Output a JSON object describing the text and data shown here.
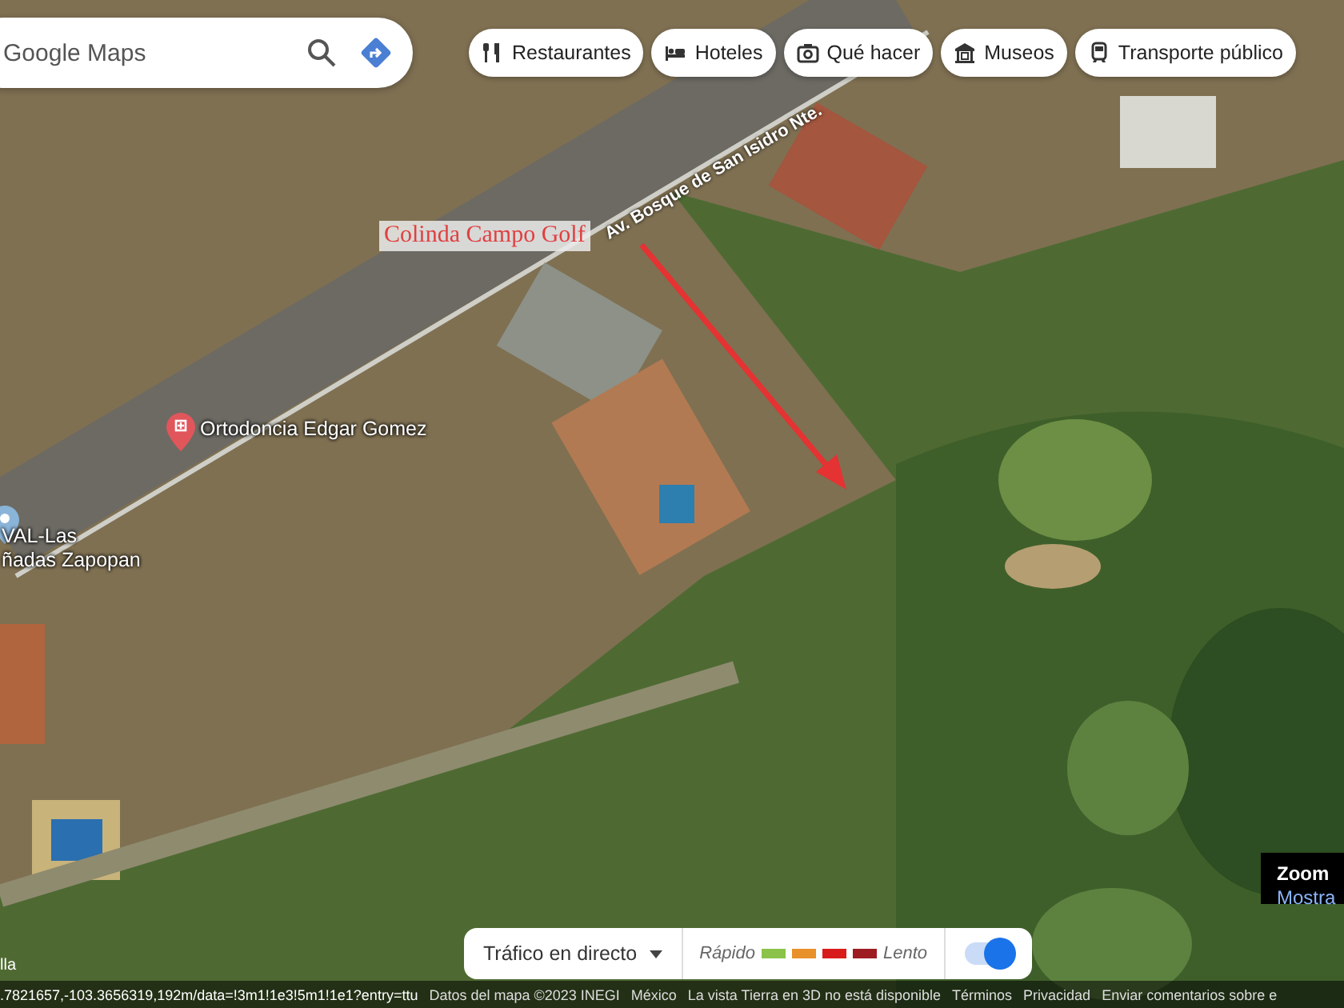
{
  "search": {
    "placeholder": "Google Maps"
  },
  "chips": [
    {
      "kind": "restaurant",
      "label": "Restaurantes"
    },
    {
      "kind": "hotel",
      "label": "Hoteles"
    },
    {
      "kind": "camera",
      "label": "Qué hacer"
    },
    {
      "kind": "museum",
      "label": "Museos"
    },
    {
      "kind": "transit",
      "label": "Transporte público"
    }
  ],
  "map": {
    "road_label": "Av. Bosque de San Isidro Nte.",
    "annotation": "Colinda Campo Golf",
    "places": [
      {
        "kind": "health",
        "lines": [
          "Ortodoncia Edgar Gomez"
        ],
        "color": "#e0565b"
      },
      {
        "kind": "generic",
        "lines": [
          "VAL-Las",
          "ñadas Zapopan"
        ],
        "color": "#8ab4d8"
      }
    ]
  },
  "zoom_tooltip": {
    "title": "Zoom",
    "link": "Mostra"
  },
  "traffic": {
    "label": "Tráfico en directo",
    "fast": "Rápido",
    "slow": "Lento",
    "legend": [
      {
        "color": "#8bc34a"
      },
      {
        "color": "#e8902a"
      },
      {
        "color": "#d81b1b"
      },
      {
        "color": "#9c1c22"
      }
    ],
    "on": true
  },
  "url_start": "lla",
  "url": ".7821657,-103.3656319,192m/data=!3m1!1e3!5m1!1e1?entry=ttu",
  "footer": [
    "Datos del mapa ©2023 INEGI",
    "México",
    "La vista Tierra en 3D no está disponible",
    "Términos",
    "Privacidad",
    "Enviar comentarios sobre e"
  ]
}
